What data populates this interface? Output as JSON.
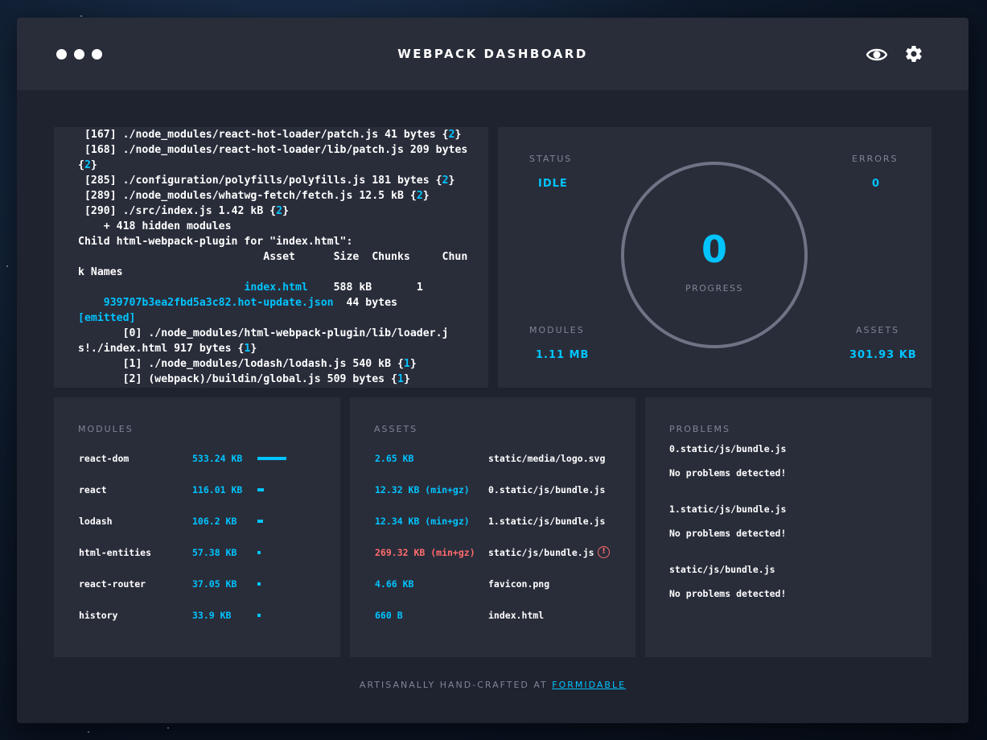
{
  "header": {
    "title": "WEBPACK DASHBOARD",
    "icons": [
      "menu-dots-icon",
      "eye-icon",
      "gear-icon"
    ]
  },
  "log": {
    "lines": [
      [
        {
          "t": " [167] ./node_modules/react-hot-loader/patch.js 41 bytes {"
        },
        {
          "t": "2",
          "c": "cyan"
        },
        {
          "t": "}"
        }
      ],
      [
        {
          "t": " [168] ./node_modules/react-hot-loader/lib/patch.js 209 bytes {"
        },
        {
          "t": "2",
          "c": "cyan"
        },
        {
          "t": "}"
        }
      ],
      [
        {
          "t": " [285] ./configuration/polyfills/polyfills.js 181 bytes {"
        },
        {
          "t": "2",
          "c": "cyan"
        },
        {
          "t": "}"
        }
      ],
      [
        {
          "t": " [289] ./node_modules/whatwg-fetch/fetch.js 12.5 kB {"
        },
        {
          "t": "2",
          "c": "cyan"
        },
        {
          "t": "}"
        }
      ],
      [
        {
          "t": " [290] ./src/index.js 1.42 kB {"
        },
        {
          "t": "2",
          "c": "cyan"
        },
        {
          "t": "}"
        }
      ],
      [
        {
          "t": "    + 418 hidden modules"
        }
      ],
      [
        {
          "t": "Child html-webpack-plugin for \"index.html\":"
        }
      ],
      [
        {
          "t": "                             Asset      Size  Chunks     Chunk Names"
        }
      ],
      [
        {
          "t": "                          "
        },
        {
          "t": "index.html",
          "c": "cyan"
        },
        {
          "t": "    588 kB       1"
        }
      ],
      [
        {
          "t": "    "
        },
        {
          "t": "939707b3ea2fbd5a3c82.hot-update.json",
          "c": "cyan"
        },
        {
          "t": "  44 bytes          "
        },
        {
          "t": "[emitted]",
          "c": "cyan"
        }
      ],
      [
        {
          "t": "       [0] ./node_modules/html-webpack-plugin/lib/loader.js!./index.html 917 bytes {"
        },
        {
          "t": "1",
          "c": "cyan"
        },
        {
          "t": "}"
        }
      ],
      [
        {
          "t": "       [1] ./node_modules/lodash/lodash.js 540 kB {"
        },
        {
          "t": "1",
          "c": "cyan"
        },
        {
          "t": "}"
        }
      ],
      [
        {
          "t": "       [2] (webpack)/buildin/global.js 509 bytes {"
        },
        {
          "t": "1",
          "c": "cyan"
        },
        {
          "t": "}"
        }
      ]
    ]
  },
  "status": {
    "status_label": "STATUS",
    "status_value": "IDLE",
    "errors_label": "ERRORS",
    "errors_value": "0",
    "progress_value": "0",
    "progress_label": "PROGRESS",
    "modules_label": "MODULES",
    "modules_value": "1.11 MB",
    "assets_label": "ASSETS",
    "assets_value": "301.93 KB"
  },
  "modules": {
    "title": "MODULES",
    "rows": [
      {
        "name": "react-dom",
        "size": "533.24 KB",
        "fraction": 1.0
      },
      {
        "name": "react",
        "size": "116.01 KB",
        "fraction": 0.22
      },
      {
        "name": "lodash",
        "size": "106.2 KB",
        "fraction": 0.2
      },
      {
        "name": "html-entities",
        "size": "57.38 KB",
        "fraction": 0.12
      },
      {
        "name": "react-router",
        "size": "37.05 KB",
        "fraction": 0.08
      },
      {
        "name": "history",
        "size": "33.9 KB",
        "fraction": 0.07
      }
    ]
  },
  "assets": {
    "title": "ASSETS",
    "rows": [
      {
        "size": "2.65 KB",
        "name": "static/media/logo.svg",
        "warn": false
      },
      {
        "size": "12.32 KB (min+gz)",
        "name": "0.static/js/bundle.js",
        "warn": false
      },
      {
        "size": "12.34 KB (min+gz)",
        "name": "1.static/js/bundle.js",
        "warn": false
      },
      {
        "size": "269.32 KB (min+gz)",
        "name": "static/js/bundle.js",
        "warn": true
      },
      {
        "size": "4.66 KB",
        "name": "favicon.png",
        "warn": false
      },
      {
        "size": "660 B",
        "name": "index.html",
        "warn": false
      }
    ],
    "warn_glyph": "!"
  },
  "problems": {
    "title": "PROBLEMS",
    "items": [
      {
        "file": "0.static/js/bundle.js",
        "message": "No problems detected!"
      },
      {
        "file": "1.static/js/bundle.js",
        "message": "No problems detected!"
      },
      {
        "file": "static/js/bundle.js",
        "message": "No problems detected!"
      }
    ]
  },
  "footer": {
    "text": "ARTISANALLY HAND-CRAFTED AT",
    "link": "FORMIDABLE"
  },
  "colors": {
    "accent": "#00c4ff",
    "error": "#ff6b6b",
    "panel": "#292d3a",
    "window": "#1f2330"
  }
}
